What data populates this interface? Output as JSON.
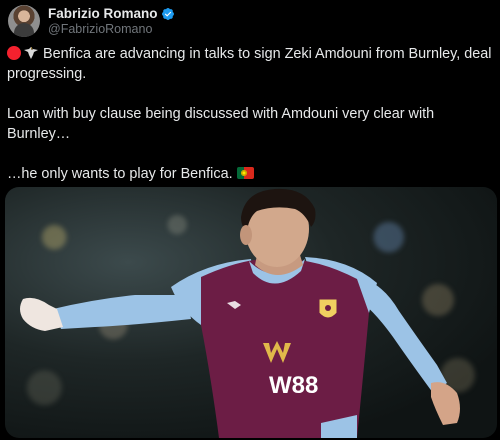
{
  "author": {
    "display_name": "Fabrizio Romano",
    "handle": "@FabrizioRomano",
    "verified": true,
    "verified_color": "#1d9bf0"
  },
  "tweet": {
    "line1_icons": [
      "red-circle-icon",
      "eagle-icon"
    ],
    "line1": "Benfica are advancing in talks to sign Zeki Amdouni from Burnley, deal progressing.",
    "line2": "Loan with buy clause being discussed with Amdouni very clear with Burnley…",
    "line3": "…he only wants to play for Benfica.",
    "line3_icon": "portugal-flag-icon"
  },
  "media": {
    "sponsor_text": "W88"
  },
  "colors": {
    "background": "#000000",
    "text": "#e7e9ea",
    "secondary_text": "#71767b",
    "jersey_claret": "#6c1d45",
    "jersey_sky_blue": "#99c1e6"
  }
}
